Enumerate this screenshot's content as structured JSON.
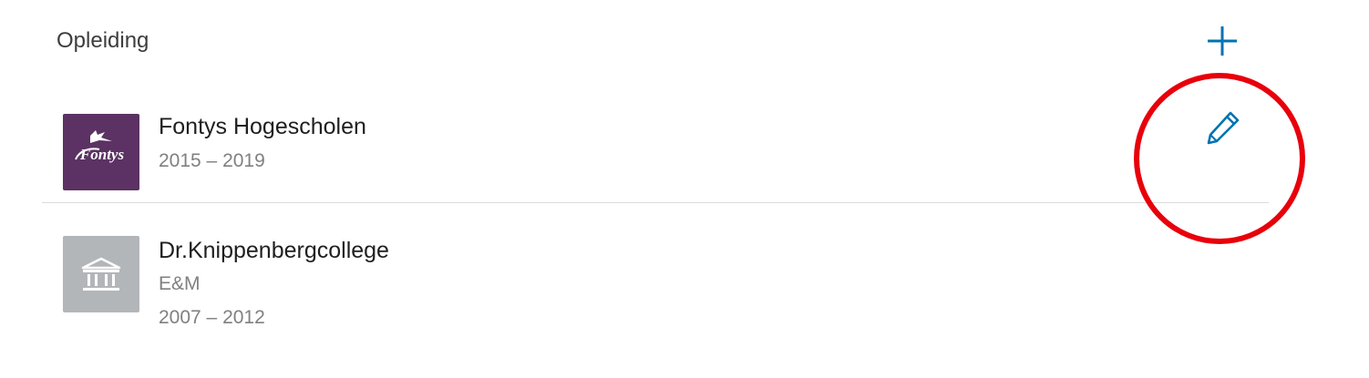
{
  "section": {
    "title": "Opleiding",
    "add_icon": "plus-icon"
  },
  "education": [
    {
      "school": "Fontys Hogescholen",
      "logo_text": "Fontys",
      "logo_color": "#5b3263",
      "dates": "2015 – 2019"
    },
    {
      "school": "Dr.Knippenbergcollege",
      "logo_icon": "school-building-icon",
      "logo_color": "#b3b6b9",
      "field": "E&M",
      "dates": "2007 – 2012"
    }
  ],
  "edit_icon": "pencil-icon",
  "colors": {
    "accent": "#0073b1",
    "annotation": "#e8000b"
  }
}
